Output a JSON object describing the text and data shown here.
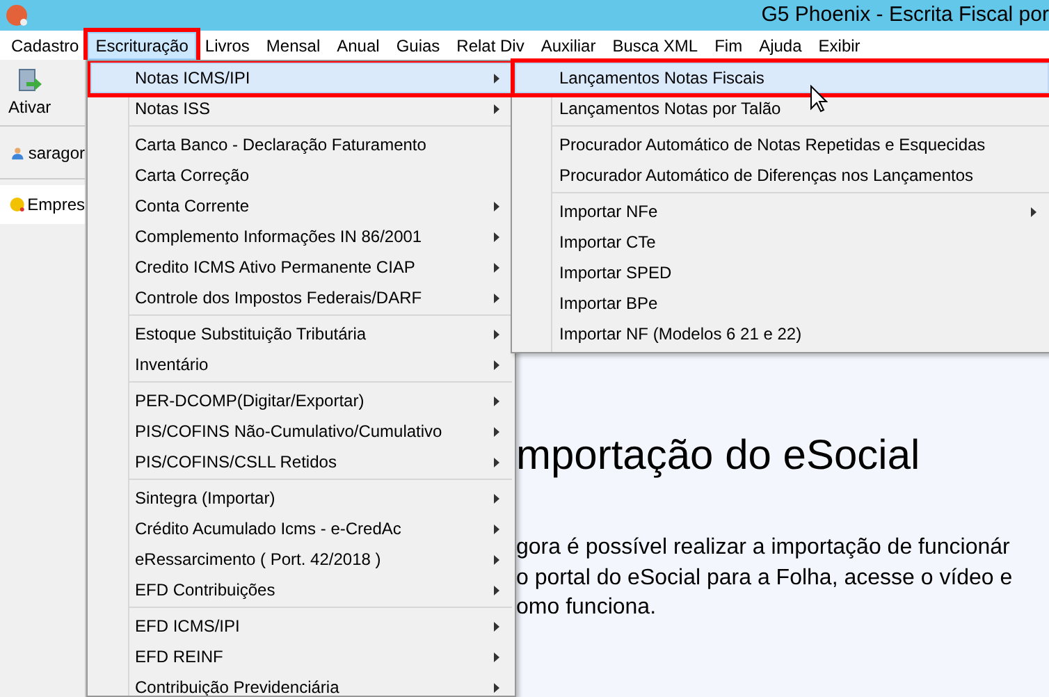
{
  "window": {
    "title": "G5 Phoenix - Escrita Fiscal por"
  },
  "menu_bar": [
    {
      "label": "Cadastro",
      "selected": false,
      "annotated": false
    },
    {
      "label": "Escrituração",
      "selected": true,
      "annotated": true
    },
    {
      "label": "Livros",
      "selected": false,
      "annotated": false
    },
    {
      "label": "Mensal",
      "selected": false,
      "annotated": false
    },
    {
      "label": "Anual",
      "selected": false,
      "annotated": false
    },
    {
      "label": "Guias",
      "selected": false,
      "annotated": false
    },
    {
      "label": "Relat Div",
      "selected": false,
      "annotated": false
    },
    {
      "label": "Auxiliar",
      "selected": false,
      "annotated": false
    },
    {
      "label": "Busca XML",
      "selected": false,
      "annotated": false
    },
    {
      "label": "Fim",
      "selected": false,
      "annotated": false
    },
    {
      "label": "Ajuda",
      "selected": false,
      "annotated": false
    },
    {
      "label": "Exibir",
      "selected": false,
      "annotated": false
    }
  ],
  "toolbar": {
    "button": "Ativar"
  },
  "sidebar": {
    "user": "saragor",
    "tab": "Empres"
  },
  "dropdown": [
    {
      "kind": "item",
      "label": "Notas ICMS/IPI",
      "submenu": true,
      "selected": true,
      "annotated": true
    },
    {
      "kind": "item",
      "label": "Notas ISS",
      "submenu": true,
      "selected": false,
      "annotated": false
    },
    {
      "kind": "separator"
    },
    {
      "kind": "item",
      "label": "Carta Banco - Declaração Faturamento",
      "submenu": false,
      "selected": false,
      "annotated": false
    },
    {
      "kind": "item",
      "label": "Carta Correção",
      "submenu": false,
      "selected": false,
      "annotated": false
    },
    {
      "kind": "item",
      "label": "Conta Corrente",
      "submenu": true,
      "selected": false,
      "annotated": false
    },
    {
      "kind": "item",
      "label": "Complemento Informações IN 86/2001",
      "submenu": true,
      "selected": false,
      "annotated": false
    },
    {
      "kind": "item",
      "label": "Credito ICMS Ativo Permanente CIAP",
      "submenu": true,
      "selected": false,
      "annotated": false
    },
    {
      "kind": "item",
      "label": "Controle dos Impostos Federais/DARF",
      "submenu": true,
      "selected": false,
      "annotated": false
    },
    {
      "kind": "separator"
    },
    {
      "kind": "item",
      "label": "Estoque Substituição Tributária",
      "submenu": true,
      "selected": false,
      "annotated": false
    },
    {
      "kind": "item",
      "label": "Inventário",
      "submenu": true,
      "selected": false,
      "annotated": false
    },
    {
      "kind": "separator"
    },
    {
      "kind": "item",
      "label": "PER-DCOMP(Digitar/Exportar)",
      "submenu": true,
      "selected": false,
      "annotated": false
    },
    {
      "kind": "item",
      "label": "PIS/COFINS Não-Cumulativo/Cumulativo",
      "submenu": true,
      "selected": false,
      "annotated": false
    },
    {
      "kind": "item",
      "label": "PIS/COFINS/CSLL Retidos",
      "submenu": true,
      "selected": false,
      "annotated": false
    },
    {
      "kind": "separator"
    },
    {
      "kind": "item",
      "label": "Sintegra (Importar)",
      "submenu": true,
      "selected": false,
      "annotated": false
    },
    {
      "kind": "item",
      "label": "Crédito Acumulado Icms - e-CredAc",
      "submenu": true,
      "selected": false,
      "annotated": false
    },
    {
      "kind": "item",
      "label": "eRessarcimento ( Port. 42/2018 )",
      "submenu": true,
      "selected": false,
      "annotated": false
    },
    {
      "kind": "item",
      "label": "EFD Contribuições",
      "submenu": true,
      "selected": false,
      "annotated": false
    },
    {
      "kind": "separator"
    },
    {
      "kind": "item",
      "label": "EFD ICMS/IPI",
      "submenu": true,
      "selected": false,
      "annotated": false
    },
    {
      "kind": "item",
      "label": "EFD REINF",
      "submenu": true,
      "selected": false,
      "annotated": false
    },
    {
      "kind": "item",
      "label": "Contribuição Previdenciária",
      "submenu": true,
      "selected": false,
      "annotated": false
    }
  ],
  "submenu": [
    {
      "kind": "item",
      "label": "Lançamentos Notas Fiscais",
      "submenu": false,
      "selected": true,
      "annotated": true
    },
    {
      "kind": "item",
      "label": "Lançamentos Notas por Talão",
      "submenu": false,
      "selected": false,
      "annotated": false
    },
    {
      "kind": "separator"
    },
    {
      "kind": "item",
      "label": "Procurador Automático de Notas Repetidas e Esquecidas",
      "submenu": false,
      "selected": false,
      "annotated": false
    },
    {
      "kind": "item",
      "label": "Procurador Automático de Diferenças nos Lançamentos",
      "submenu": false,
      "selected": false,
      "annotated": false
    },
    {
      "kind": "separator"
    },
    {
      "kind": "item",
      "label": "Importar NFe",
      "submenu": true,
      "selected": false,
      "annotated": false
    },
    {
      "kind": "item",
      "label": "Importar CTe",
      "submenu": false,
      "selected": false,
      "annotated": false
    },
    {
      "kind": "item",
      "label": "Importar SPED",
      "submenu": false,
      "selected": false,
      "annotated": false
    },
    {
      "kind": "item",
      "label": "Importar BPe",
      "submenu": false,
      "selected": false,
      "annotated": false
    },
    {
      "kind": "item",
      "label": "Importar NF (Modelos 6 21 e 22)",
      "submenu": false,
      "selected": false,
      "annotated": false
    }
  ],
  "content": {
    "heading": "mportação do eSocial",
    "lines": [
      "gora é possível realizar a importação de funcionár",
      "o portal do eSocial para a Folha, acesse o vídeo e",
      "omo funciona."
    ]
  }
}
